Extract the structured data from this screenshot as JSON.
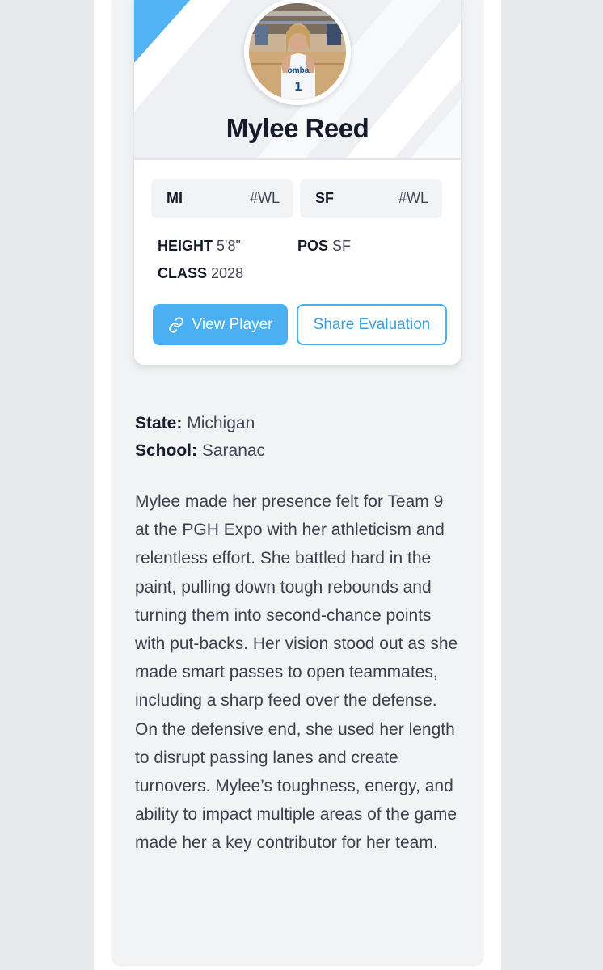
{
  "player": {
    "name": "Mylee Reed",
    "jersey_text": "omba",
    "jersey_number": "1"
  },
  "badges": [
    {
      "state": "MI",
      "tag": "#WL"
    },
    {
      "state": "SF",
      "tag": "#WL"
    }
  ],
  "stats": {
    "height_label": "HEIGHT",
    "height_value": "5'8\"",
    "pos_label": "POS",
    "pos_value": "SF",
    "class_label": "CLASS",
    "class_value": "2028"
  },
  "actions": {
    "view_player": "View Player",
    "share_evaluation": "Share Evaluation"
  },
  "details": {
    "state_label": "State:",
    "state_value": "Michigan",
    "school_label": "School:",
    "school_value": "Saranac"
  },
  "bio": "Mylee made her presence felt for Team 9 at the PGH Expo with her athleticism and relentless effort. She battled hard in the paint, pulling down tough rebounds and turning them into second-chance points with put-backs. Her vision stood out as she made smart passes to open teammates, including a sharp feed over the defense. On the defensive end, she used her length to disrupt passing lanes and create turnovers. Mylee’s toughness, energy, and ability to impact multiple areas of the game made her a key contributor for her team.",
  "colors": {
    "accent": "#4ab0f2",
    "name_text": "#151b2b",
    "body_text": "#3a404c"
  },
  "icons": {
    "link": "link-icon"
  }
}
